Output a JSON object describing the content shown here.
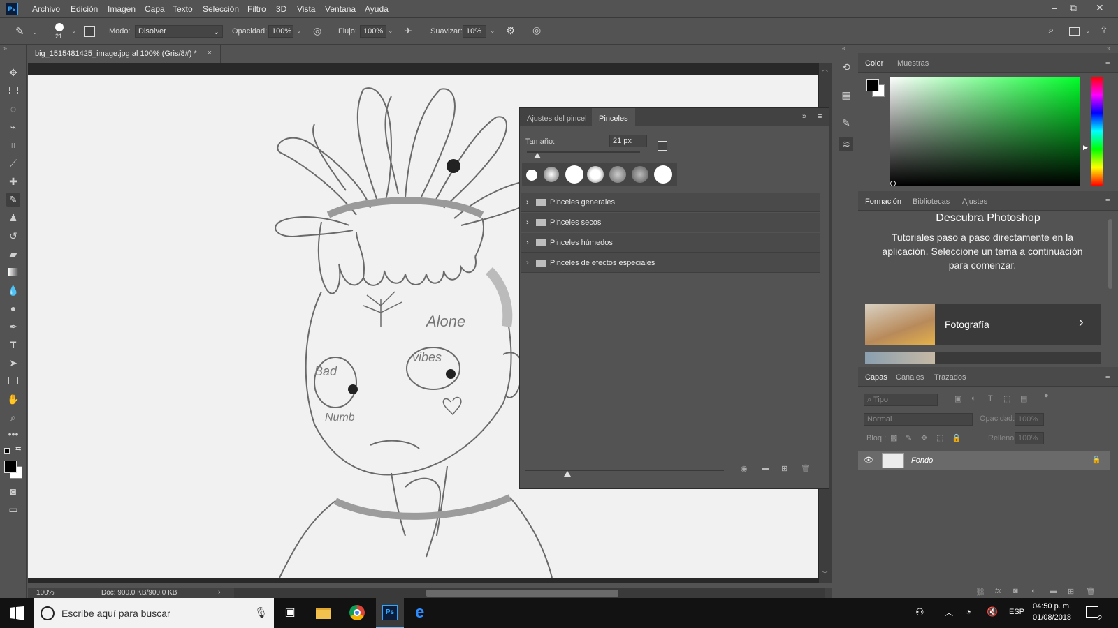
{
  "app": {
    "logo": "Ps"
  },
  "menu": [
    "Archivo",
    "Edición",
    "Imagen",
    "Capa",
    "Texto",
    "Selección",
    "Filtro",
    "3D",
    "Vista",
    "Ventana",
    "Ayuda"
  ],
  "options": {
    "brush_size": "21",
    "mode_label": "Modo:",
    "mode_value": "Disolver",
    "opacity_label": "Opacidad:",
    "opacity_value": "100%",
    "flow_label": "Flujo:",
    "flow_value": "100%",
    "smooth_label": "Suavizar:",
    "smooth_value": "10%"
  },
  "document": {
    "tab_title": "big_1515481425_image.jpg al 100% (Gris/8#) *",
    "close": "×",
    "sketch_text": {
      "alone": "Alone",
      "vibes": "vibes",
      "bad": "Bad",
      "numb": "Numb"
    }
  },
  "status": {
    "zoom": "100%",
    "doc_info": "Doc: 900.0 KB/900.0 KB",
    "arrow": "›"
  },
  "brush_panel": {
    "tab_settings": "Ajustes del pincel",
    "tab_brushes": "Pinceles",
    "size_label": "Tamaño:",
    "size_value": "21 px",
    "folders": [
      "Pinceles generales",
      "Pinceles secos",
      "Pinceles húmedos",
      "Pinceles de efectos especiales"
    ]
  },
  "color_panel": {
    "tab_color": "Color",
    "tab_swatches": "Muestras"
  },
  "learn_panel": {
    "tab_learn": "Formación",
    "tab_libraries": "Bibliotecas",
    "tab_adjustments": "Ajustes",
    "title": "Descubra Photoshop",
    "description": "Tutoriales paso a paso directamente en la aplicación. Seleccione un tema a continuación para comenzar.",
    "card_label": "Fotografía"
  },
  "layers_panel": {
    "tab_layers": "Capas",
    "tab_channels": "Canales",
    "tab_paths": "Trazados",
    "filter_placeholder": "Tipo",
    "blend_mode": "Normal",
    "opacity_label": "Opacidad:",
    "opacity_value": "100%",
    "lock_label": "Bloq.:",
    "fill_label": "Relleno:",
    "fill_value": "100%",
    "layer_name": "Fondo"
  },
  "taskbar": {
    "search_placeholder": "Escribe aquí para buscar",
    "language": "ESP",
    "time": "04:50 p. m.",
    "date": "01/08/2018",
    "notifications": "2"
  },
  "colors": {
    "bg": "#535353",
    "canvas": "#282828",
    "accent": "#31a8ff",
    "hue_green": "#00ff2a"
  }
}
